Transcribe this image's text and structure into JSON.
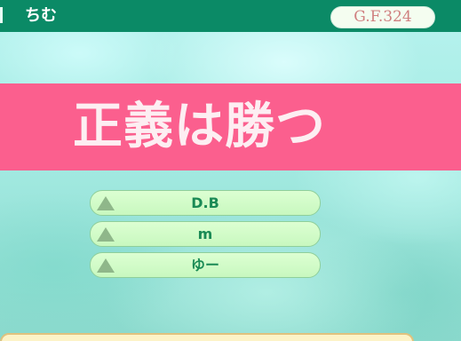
{
  "header": {
    "player_name": "ちむ",
    "gf_label": "G.F.324"
  },
  "banner": {
    "title": "正義は勝つ"
  },
  "members": [
    {
      "name": "D.B"
    },
    {
      "name": "m"
    },
    {
      "name": "ゆー"
    }
  ],
  "colors": {
    "topbar": "#0b8a66",
    "banner": "#fb5f8e",
    "row_fill": "#d4fdca",
    "row_text": "#1a8a55",
    "badge_text": "#d08080"
  }
}
